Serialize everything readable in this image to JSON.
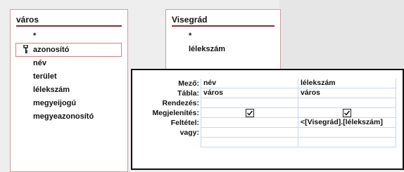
{
  "table1": {
    "title": "város",
    "fields": [
      "*",
      "azonosító",
      "név",
      "terület",
      "lélekszám",
      "megyeijogú",
      "megyeazonosító"
    ]
  },
  "table2": {
    "title": "Visegrád",
    "fields": [
      "*",
      "lélekszám"
    ]
  },
  "grid": {
    "row_labels": [
      "Mező:",
      "Tábla:",
      "Rendezés:",
      "Megjelenítés:",
      "Feltétel:",
      "vagy:"
    ],
    "columns": [
      {
        "field": "név",
        "table": "város",
        "sort": "",
        "show": true,
        "criteria": "",
        "or": ""
      },
      {
        "field": "lélekszám",
        "table": "város",
        "sort": "",
        "show": true,
        "criteria": "<[Visegrád].[lélekszám]",
        "or": ""
      }
    ]
  }
}
